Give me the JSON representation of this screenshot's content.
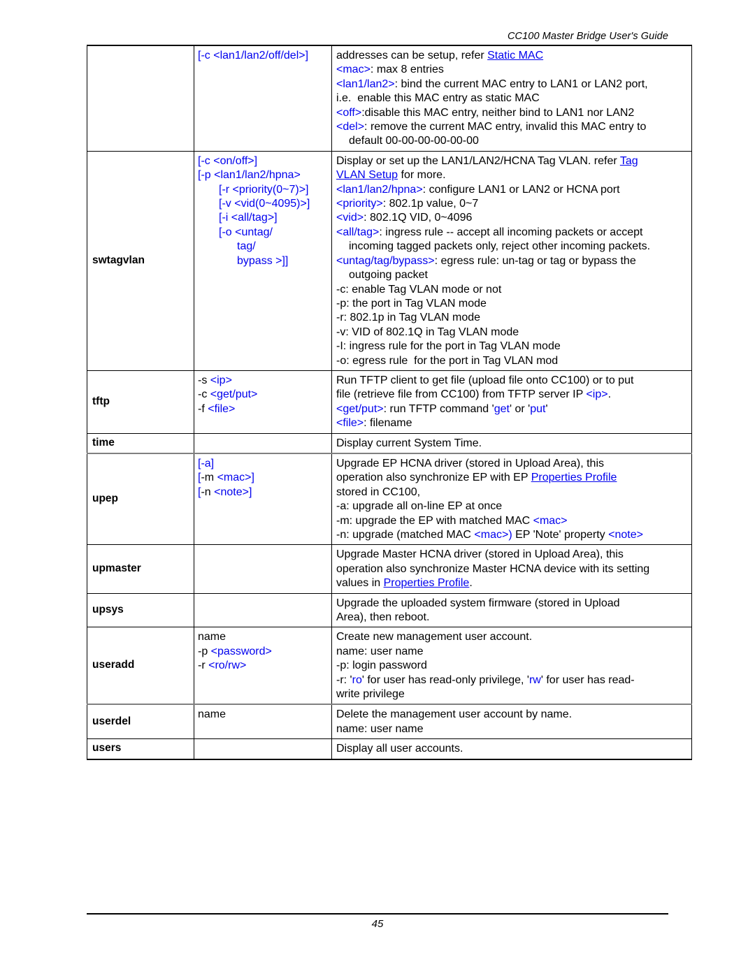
{
  "header": {
    "running_title": "CC100 Master Bridge User's Guide"
  },
  "footer": {
    "page_number": "45"
  },
  "colors": {
    "link": "#0000ee",
    "parameter": "#0000ee",
    "text": "#000000",
    "border": "#000000"
  },
  "table": {
    "rows": [
      {
        "name": "",
        "syntax_lines": [
          "[-c <lan1/lan2/off/del>]"
        ],
        "desc_lines": [
          "addresses can be setup, refer Static MAC",
          "<mac>: max 8 entries",
          "<lan1/lan2>: bind the current MAC entry to LAN1 or LAN2 port,",
          "i.e.  enable this MAC entry as static MAC",
          "<off>:disable this MAC entry, neither bind to LAN1 nor LAN2",
          "<del>: remove the current MAC entry, invalid this MAC entry to",
          "default 00-00-00-00-00-00"
        ]
      },
      {
        "name": "swtagvlan",
        "syntax_lines": [
          "[-c <on/off>]",
          "[-p <lan1/lan2/hpna>",
          "[-r <priority(0~7)>]",
          "[-v <vid(0~4095)>]",
          "[-i <all/tag>]",
          "[-o <untag/",
          "tag/",
          "bypass >]]"
        ],
        "desc_lines": [
          "Display or set up the LAN1/LAN2/HCNA Tag VLAN. refer Tag",
          "VLAN Setup for more.",
          "<lan1/lan2/hpna>: configure LAN1 or LAN2 or HCNA port",
          "<priority>: 802.1p value, 0~7",
          "<vid>: 802.1Q VID, 0~4096",
          "<all/tag>: ingress rule -- accept all incoming packets or accept",
          "incoming tagged packets only, reject other incoming packets.",
          "<untag/tag/bypass>: egress rule: un-tag or tag or bypass the",
          "outgoing packet",
          "-c: enable Tag VLAN mode or not",
          "-p: the port in Tag VLAN mode",
          "-r: 802.1p in Tag VLAN mode",
          "-v: VID of 802.1Q in Tag VLAN mode",
          "-I: ingress rule for the port in Tag VLAN mode",
          "-o: egress rule  for the port in Tag VLAN mod"
        ]
      },
      {
        "name": "tftp",
        "syntax_lines": [
          "-s <ip>",
          "-c <get/put>",
          "-f <file>"
        ],
        "desc_lines": [
          "Run TFTP client to get file (upload file onto CC100) or to put",
          "file (retrieve file from CC100) from TFTP server IP <ip>.",
          "<get/put>: run TFTP command 'get' or 'put'",
          "<file>: filename"
        ]
      },
      {
        "name": "time",
        "syntax_lines": [],
        "desc_lines": [
          "Display current System Time."
        ]
      },
      {
        "name": "upep",
        "syntax_lines": [
          "[-a]",
          "[-m <mac>]",
          "[-n <note>]"
        ],
        "desc_lines": [
          "Upgrade EP HCNA driver (stored in Upload Area), this",
          "operation also synchronize EP with EP Properties Profile",
          "stored in CC100,",
          "-a: upgrade all on-line EP at once",
          "-m: upgrade the EP with matched MAC <mac>",
          "-n: upgrade (matched MAC <mac>) EP 'Note' property <note>"
        ]
      },
      {
        "name": "upmaster",
        "syntax_lines": [],
        "desc_lines": [
          "Upgrade Master HCNA driver (stored in Upload Area), this",
          "operation also synchronize Master HCNA device with its setting",
          "values in Properties Profile."
        ]
      },
      {
        "name": "upsys",
        "syntax_lines": [],
        "desc_lines": [
          "Upgrade the uploaded system firmware (stored in Upload",
          "Area), then reboot."
        ]
      },
      {
        "name": "useradd",
        "syntax_lines": [
          "name",
          "-p <password>",
          "-r <ro/rw>"
        ],
        "desc_lines": [
          "Create new management user account.",
          "name: user name",
          "-p: login password",
          "-r: 'ro' for user has read-only privilege, 'rw' for user has read-",
          "write privilege"
        ]
      },
      {
        "name": "userdel",
        "syntax_lines": [
          "name"
        ],
        "desc_lines": [
          "Delete the management user account by name.",
          "name: user name"
        ]
      },
      {
        "name": "users",
        "syntax_lines": [],
        "desc_lines": [
          "Display all user accounts."
        ]
      }
    ]
  }
}
